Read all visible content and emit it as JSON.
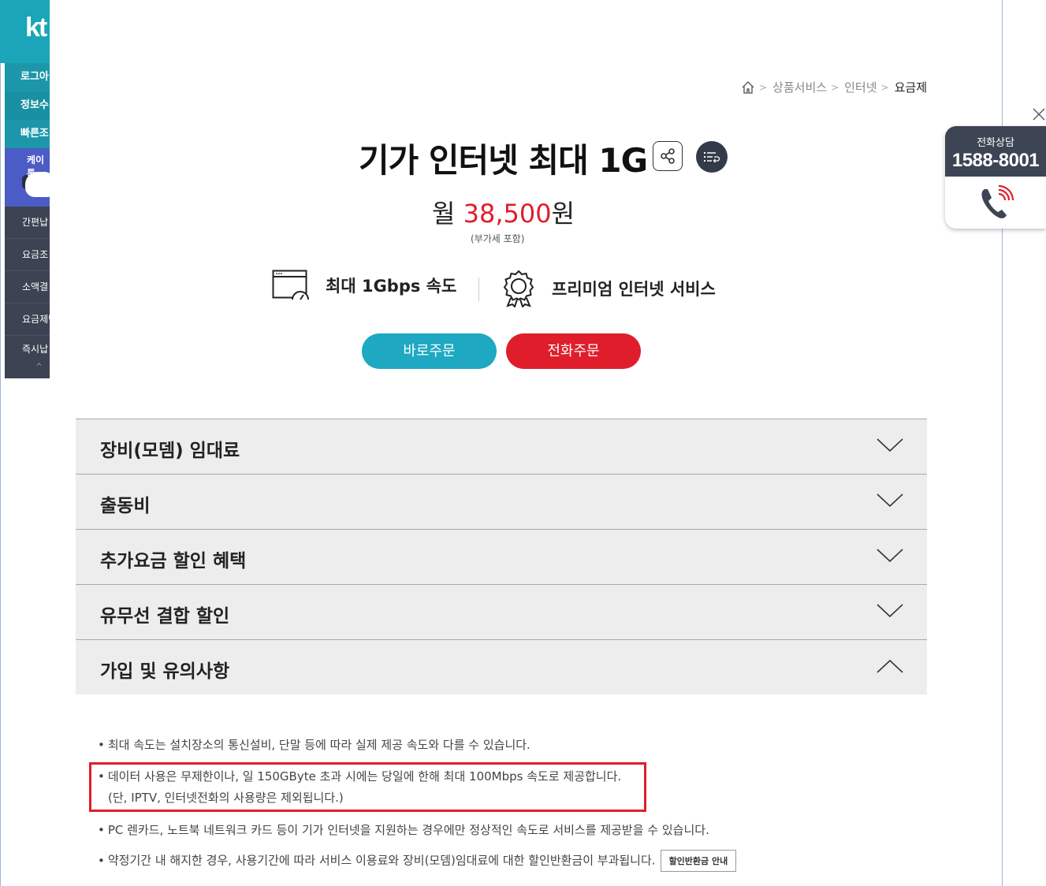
{
  "left_sidebar": {
    "logo": "kt",
    "items": [
      "로그아",
      "정보수",
      "빠른조"
    ],
    "character_label": "케이톡",
    "dark_items": [
      "간편납",
      "요금조",
      "소액결",
      "요금제변",
      "즉시납"
    ],
    "scroll_up": "^"
  },
  "breadcrumb": {
    "items": [
      "상품서비스",
      "인터넷"
    ],
    "current": "요금제",
    "separator": ">"
  },
  "product": {
    "title": "기가 인터넷 최대 1G",
    "price_prefix": "월 ",
    "price_amount": "38,500",
    "price_suffix": "원",
    "vat_note": "(부가세 포함)",
    "features": [
      {
        "icon": "speed-meter-icon",
        "label": "최대 1Gbps 속도"
      },
      {
        "icon": "award-badge-icon",
        "label": "프리미엄 인터넷 서비스"
      }
    ],
    "order_button": "바로주문",
    "phone_order_button": "전화주문"
  },
  "accordion": [
    {
      "title": "장비(모뎀) 임대료",
      "expanded": false
    },
    {
      "title": "출동비",
      "expanded": false
    },
    {
      "title": "추가요금 할인 혜택",
      "expanded": false
    },
    {
      "title": "유무선 결합 할인",
      "expanded": false
    },
    {
      "title": "가입 및 유의사항",
      "expanded": true
    }
  ],
  "notes": {
    "bullet": "•",
    "items": [
      "최대 속도는 설치장소의 통신설비, 단말 등에 따라 실제 제공 속도와 다를 수 있습니다.",
      "데이터 사용은 무제한이나, 일 150GByte 초과 시에는 당일에 한해 최대 100Mbps 속도로 제공합니다.",
      "(단, IPTV, 인터넷전화의 사용량은 제외됩니다.)",
      "PC 렌카드, 노트북 네트워크 카드 등이 기가 인터넷을 지원하는 경우에만 정상적인 속도로 서비스를 제공받을 수 있습니다.",
      "약정기간 내 해지한 경우, 사용기간에 따라 서비스 이용료와 장비(모뎀)임대료에 대한 할인반환금이 부과됩니다."
    ],
    "refund_button": "할인반환금 안내"
  },
  "consult": {
    "label": "전화상담",
    "number": "1588-8001"
  },
  "colors": {
    "accent_red": "#e01e2b",
    "accent_teal": "#1ea8c2",
    "dark_navy": "#3d4453"
  }
}
